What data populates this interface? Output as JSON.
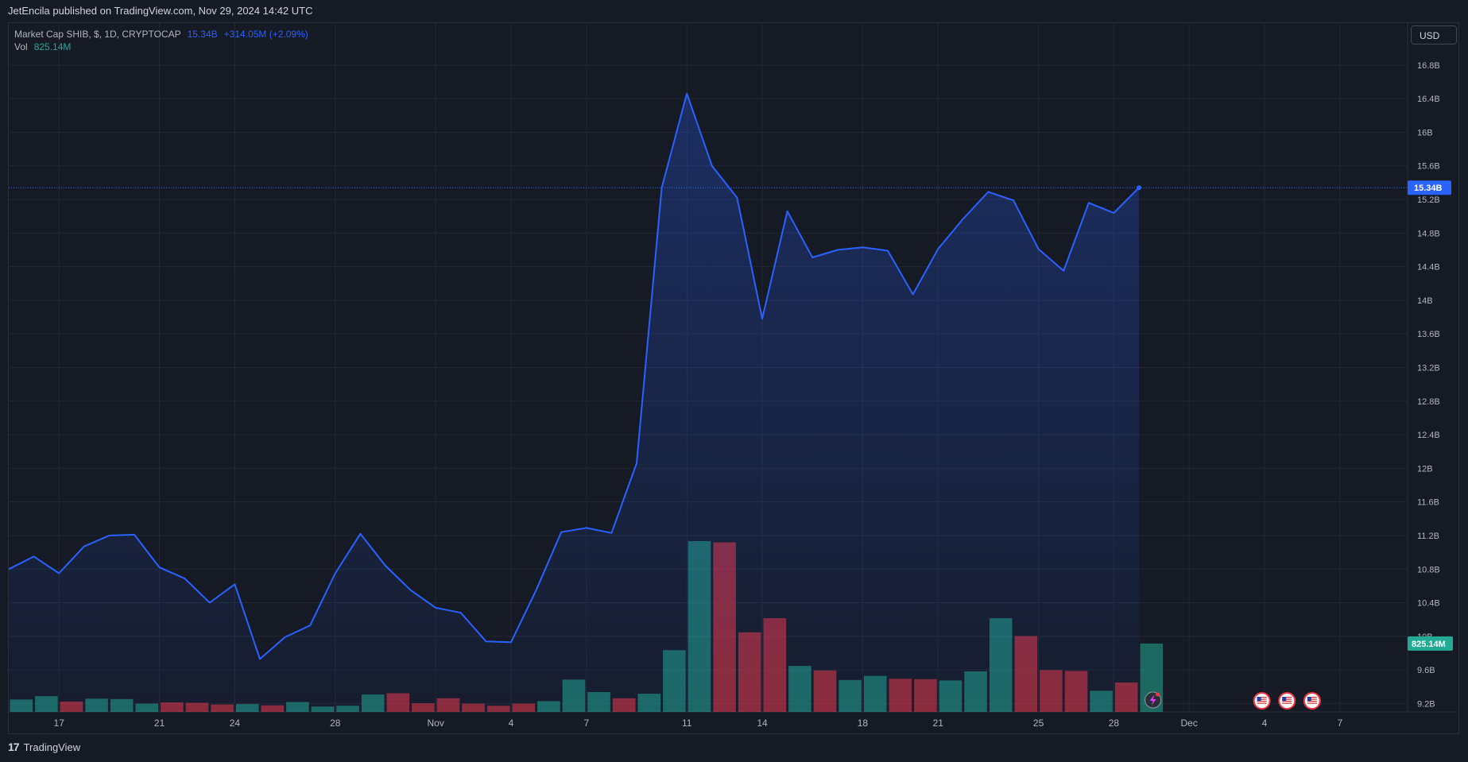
{
  "header": {
    "published_text": "JetEncila published on TradingView.com, Nov 29, 2024 14:42 UTC"
  },
  "legend": {
    "symbol": "Market Cap SHIB, $, 1D, CRYPTOCAP",
    "last_value": "15.34B",
    "change": "+314.05M (+2.09%)",
    "vol_label": "Vol",
    "vol_value": "825.14M"
  },
  "currency_button": {
    "label": "USD"
  },
  "footer": {
    "logo_glyph": "17",
    "brand": "TradingView"
  },
  "colors": {
    "background": "#161a25",
    "grid": "#232733",
    "line": "#2962ff",
    "vol_up": "#22ab94",
    "vol_down": "#f23645",
    "price_badge": "#2962ff",
    "vol_badge": "#22ab94"
  },
  "chart_data": {
    "type": "area",
    "title": "Market Cap SHIB, $, 1D, CRYPTOCAP",
    "x_tick_labels": [
      "17",
      "21",
      "24",
      "28",
      "Nov",
      "4",
      "7",
      "11",
      "14",
      "18",
      "21",
      "25",
      "28",
      "Dec",
      "4",
      "7"
    ],
    "y_tick_labels": [
      "16.8B",
      "16.4B",
      "16B",
      "15.6B",
      "15.2B",
      "14.8B",
      "14.4B",
      "14B",
      "13.6B",
      "13.2B",
      "12.8B",
      "12.4B",
      "12B",
      "11.6B",
      "11.2B",
      "10.8B",
      "10.4B",
      "10B",
      "9.6B",
      "9.2B"
    ],
    "ylim": [
      9.1,
      17.3
    ],
    "y_unit": "B",
    "x": [
      "Oct 15",
      "Oct 16",
      "Oct 17",
      "Oct 18",
      "Oct 19",
      "Oct 20",
      "Oct 21",
      "Oct 22",
      "Oct 23",
      "Oct 24",
      "Oct 25",
      "Oct 26",
      "Oct 27",
      "Oct 28",
      "Oct 29",
      "Oct 30",
      "Oct 31",
      "Nov 1",
      "Nov 2",
      "Nov 3",
      "Nov 4",
      "Nov 5",
      "Nov 6",
      "Nov 7",
      "Nov 8",
      "Nov 9",
      "Nov 10",
      "Nov 11",
      "Nov 12",
      "Nov 13",
      "Nov 14",
      "Nov 15",
      "Nov 16",
      "Nov 17",
      "Nov 18",
      "Nov 19",
      "Nov 20",
      "Nov 21",
      "Nov 22",
      "Nov 23",
      "Nov 24",
      "Nov 25",
      "Nov 26",
      "Nov 27",
      "Nov 28",
      "Nov 29"
    ],
    "series": [
      {
        "type": "line",
        "values": [
          10.8,
          10.95,
          10.75,
          11.07,
          11.2,
          11.21,
          10.82,
          10.69,
          10.4,
          10.62,
          9.73,
          9.99,
          10.13,
          10.75,
          11.22,
          10.84,
          10.55,
          10.34,
          10.28,
          9.94,
          9.93,
          10.55,
          11.24,
          11.29,
          11.23,
          12.06,
          15.34,
          16.46,
          15.6,
          15.22,
          13.78,
          15.06,
          14.51,
          14.6,
          14.63,
          14.59,
          14.07,
          14.61,
          14.97,
          15.29,
          15.19,
          14.61,
          14.35,
          15.16,
          15.04,
          15.34
        ]
      },
      {
        "type": "bar",
        "name": "Vol",
        "unit": "M",
        "values": [
          150,
          190,
          125,
          160,
          155,
          100,
          115,
          110,
          90,
          95,
          80,
          120,
          65,
          75,
          210,
          225,
          105,
          165,
          100,
          75,
          100,
          130,
          390,
          240,
          165,
          220,
          745,
          2060,
          2045,
          960,
          1130,
          555,
          500,
          385,
          435,
          400,
          395,
          380,
          490,
          1130,
          915,
          505,
          495,
          255,
          355,
          825.14
        ],
        "up": [
          true,
          true,
          false,
          true,
          true,
          true,
          false,
          false,
          false,
          true,
          false,
          true,
          true,
          true,
          true,
          false,
          false,
          false,
          false,
          false,
          false,
          true,
          true,
          true,
          false,
          true,
          true,
          true,
          false,
          false,
          false,
          true,
          false,
          true,
          true,
          false,
          false,
          true,
          true,
          true,
          false,
          false,
          false,
          true,
          false,
          true
        ]
      }
    ],
    "current_price_label": "15.34B",
    "current_volume_label": "825.14M",
    "grid": true,
    "event_flags": [
      "us-flag",
      "us-flag",
      "us-flag"
    ]
  }
}
